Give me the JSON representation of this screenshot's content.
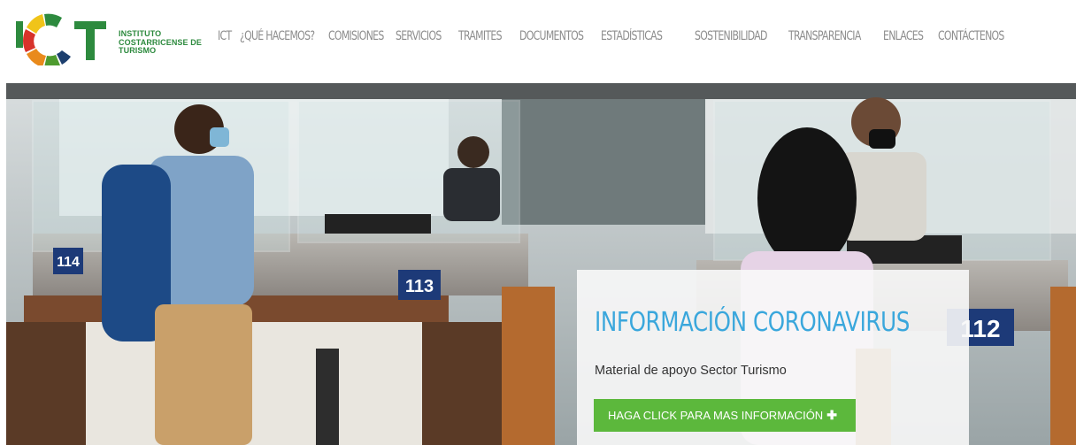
{
  "brand": {
    "name_lines": [
      "INSTITUTO",
      "COSTARRICENSE DE",
      "TURISMO"
    ],
    "logo_mark": "ICT",
    "colors": {
      "green": "#2d8a3e",
      "orange": "#e98a1c",
      "red": "#d7332b",
      "yellow": "#f0c419",
      "navy": "#1d3f6e"
    }
  },
  "nav": {
    "items": [
      "ICT",
      "¿QUÉ HACEMOS?",
      "COMISIONES",
      "SERVICIOS",
      "TRAMITES",
      "DOCUMENTOS",
      "ESTADÍSTICAS",
      "SOSTENIBILIDAD",
      "TRANSPARENCIA",
      "ENLACES",
      "CONTÁCTENOS"
    ]
  },
  "hero": {
    "counter_numbers": [
      "114",
      "113",
      "112"
    ],
    "card": {
      "title": "INFORMACIÓN CORONAVIRUS",
      "subtitle": "Material de apoyo Sector Turismo",
      "button_label": "HAGA CLICK PARA MAS INFORMACIÓN",
      "button_icon": "plus-icon",
      "accent": "#3aa7dc",
      "button_color": "#5cb83c"
    }
  }
}
